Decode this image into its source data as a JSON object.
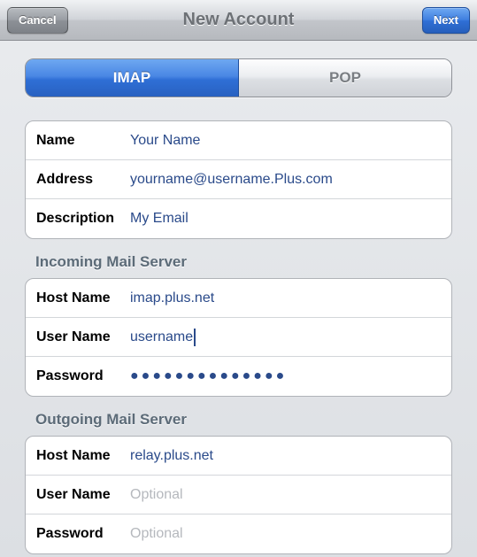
{
  "header": {
    "cancel": "Cancel",
    "title": "New Account",
    "next": "Next"
  },
  "tabs": {
    "imap": "IMAP",
    "pop": "POP"
  },
  "account": {
    "name_label": "Name",
    "name_value": "Your Name",
    "address_label": "Address",
    "address_value": "yourname@username.Plus.com",
    "description_label": "Description",
    "description_value": "My Email"
  },
  "incoming": {
    "title": "Incoming Mail Server",
    "host_label": "Host Name",
    "host_value": "imap.plus.net",
    "user_label": "User Name",
    "user_value": "username",
    "password_label": "Password",
    "password_value": "●●●●●●●●●●●●●●"
  },
  "outgoing": {
    "title": "Outgoing Mail Server",
    "host_label": "Host Name",
    "host_value": "relay.plus.net",
    "user_label": "User Name",
    "user_placeholder": "Optional",
    "password_label": "Password",
    "password_placeholder": "Optional"
  }
}
